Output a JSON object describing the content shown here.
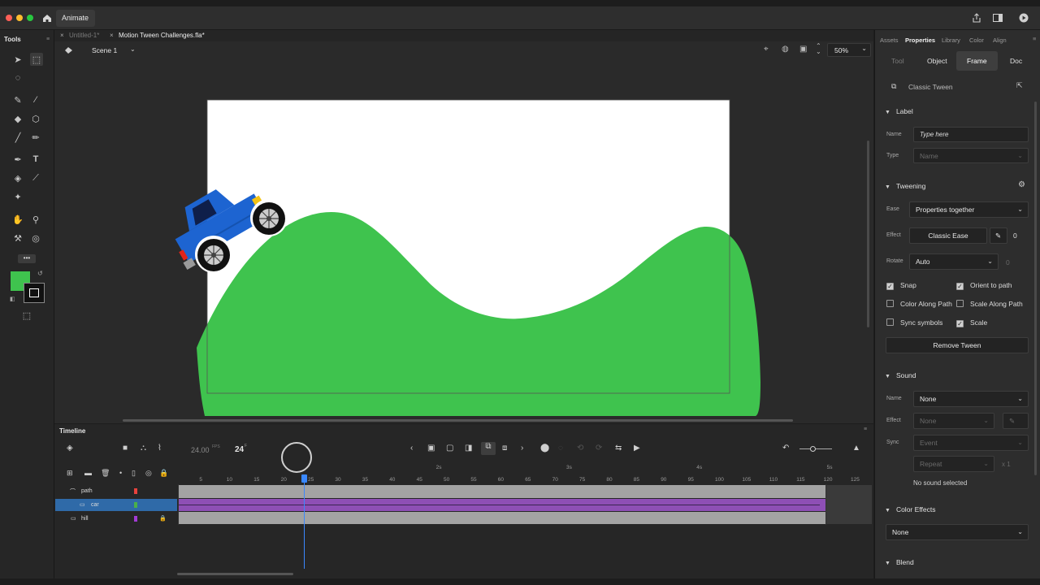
{
  "app": {
    "name": "Animate"
  },
  "doc_tabs": [
    "Untitled-1*",
    "Motion Tween Challenges.fla*"
  ],
  "tools_panel": {
    "title": "Tools"
  },
  "stage_bar": {
    "scene": "Scene 1",
    "zoom": "50%"
  },
  "timeline": {
    "title": "Timeline",
    "fps": "24.00",
    "fps_unit": "FPS",
    "frame": "24",
    "frame_unit": "F",
    "ruler_seconds": [
      "2s",
      "3s",
      "4s",
      "5s"
    ],
    "ruler_frames": [
      "5",
      "10",
      "15",
      "20",
      "25",
      "30",
      "35",
      "40",
      "45",
      "50",
      "55",
      "60",
      "65",
      "70",
      "75",
      "80",
      "85",
      "90",
      "95",
      "100",
      "105",
      "110",
      "115",
      "120",
      "125"
    ],
    "layers": [
      {
        "name": "path",
        "color": "#e8423c"
      },
      {
        "name": "car",
        "color": "#4ab04a",
        "selected": true
      },
      {
        "name": "hill",
        "color": "#a23bd4",
        "locked": true
      }
    ]
  },
  "properties": {
    "tabs": [
      "Assets",
      "Properties",
      "Library",
      "Color",
      "Align"
    ],
    "subtabs": [
      "Tool",
      "Object",
      "Frame",
      "Doc"
    ],
    "header": "Classic Tween",
    "label_section": {
      "title": "Label",
      "name_label": "Name",
      "name_placeholder": "Type here",
      "type_label": "Type",
      "type_value": "Name"
    },
    "tweening": {
      "title": "Tweening",
      "ease_label": "Ease",
      "ease_value": "Properties together",
      "effect_label": "Effect",
      "effect_value": "Classic Ease",
      "effect_amount": "0",
      "rotate_label": "Rotate",
      "rotate_value": "Auto",
      "rotate_count": "0",
      "checks": [
        {
          "label": "Snap",
          "checked": true
        },
        {
          "label": "Orient to path",
          "checked": true
        },
        {
          "label": "Color Along Path",
          "checked": false
        },
        {
          "label": "Scale Along Path",
          "checked": false
        },
        {
          "label": "Sync symbols",
          "checked": false
        },
        {
          "label": "Scale",
          "checked": true
        }
      ],
      "remove_button": "Remove Tween"
    },
    "sound": {
      "title": "Sound",
      "name_label": "Name",
      "name_value": "None",
      "effect_label": "Effect",
      "effect_value": "None",
      "sync_label": "Sync",
      "sync_value": "Event",
      "repeat_value": "Repeat",
      "repeat_count": "x 1",
      "status": "No sound selected"
    },
    "color_effects": {
      "title": "Color Effects",
      "value": "None"
    },
    "blend": {
      "title": "Blend"
    }
  },
  "colors": {
    "hill": "#3fc34e",
    "car_body": "#1d64d1",
    "fill_swatch": "#3fc34e",
    "playhead": "#3a88ff",
    "tween_gray": "#a3a3a3",
    "tween_purple": "#8e4fb5"
  }
}
